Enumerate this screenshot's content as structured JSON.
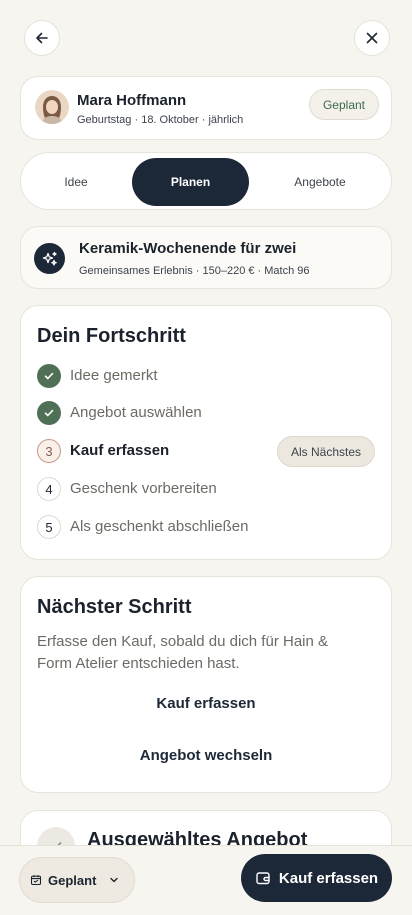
{
  "header": {
    "back_icon": "arrow-left-icon",
    "close_icon": "close-icon"
  },
  "person": {
    "name": "Mara Hoffmann",
    "subtitle": "Geburtstag · 18. Oktober · jährlich",
    "status": "Geplant"
  },
  "tabs": [
    {
      "label": "Idee",
      "active": false
    },
    {
      "label": "Planen",
      "active": true
    },
    {
      "label": "Angebote",
      "active": false
    }
  ],
  "idea": {
    "icon": "sparkles-icon",
    "title": "Keramik-Wochenende für zwei",
    "subtitle": "Gemeinsames Erlebnis · 150–220 € · Match 96"
  },
  "progress": {
    "title": "Dein Fortschritt",
    "next_badge": "Als Nächstes",
    "steps": [
      {
        "label": "Idee gemerkt",
        "state": "done",
        "number": "1"
      },
      {
        "label": "Angebot auswählen",
        "state": "done",
        "number": "2"
      },
      {
        "label": "Kauf erfassen",
        "state": "current",
        "number": "3"
      },
      {
        "label": "Geschenk vorbereiten",
        "state": "todo",
        "number": "4"
      },
      {
        "label": "Als geschenkt abschließen",
        "state": "todo",
        "number": "5"
      }
    ]
  },
  "next_step": {
    "title": "Nächster Schritt",
    "description": "Erfasse den Kauf, sobald du dich für Hain & Form Atelier entschieden hast.",
    "primary_label": "Kauf erfassen",
    "secondary_label": "Angebot wechseln"
  },
  "selected_offer": {
    "title": "Ausgewähltes Angebot"
  },
  "bottom_bar": {
    "status_label": "Geplant",
    "cta_label": "Kauf erfassen"
  },
  "colors": {
    "background": "#f7f5f0",
    "primary": "#1c2837",
    "success": "#4f7057",
    "status_text": "#3e6a4a"
  }
}
